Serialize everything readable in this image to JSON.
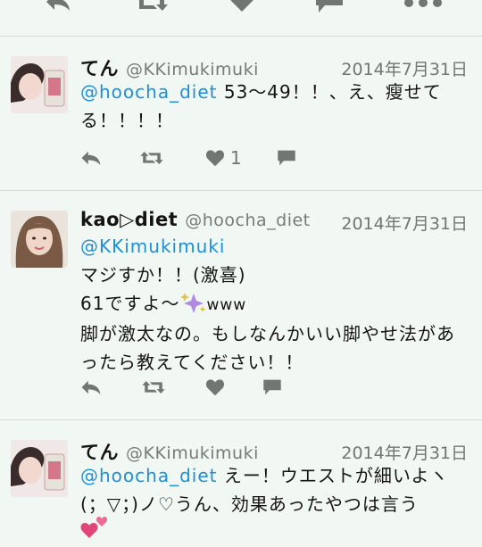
{
  "colors": {
    "background": "#f1f7f2",
    "mention": "#1f8fd6",
    "icon": "#6f7770",
    "divider": "#d6dcd6"
  },
  "top_bar": {
    "icons": [
      "reply-icon",
      "retweet-icon",
      "heart-icon",
      "message-icon",
      "more-icon"
    ]
  },
  "tweets": [
    {
      "name": "てん",
      "handle": "@KKimukimuki",
      "date": "2014年7月31日",
      "mention": "@hoocha_diet",
      "text": " 53〜49！！、え、瘦せてる！！！！",
      "like_count": "1"
    },
    {
      "name": "kao▷diet",
      "handle": "@hoocha_diet",
      "date": "2014年7月31日",
      "mention": "@KKimukimuki",
      "lines": [
        "マジすか！！(激喜)",
        "61ですよ〜",
        "www",
        "脚が激太なの。もしなんかいい脚やせ法があったら教えてください！！"
      ],
      "emoji": "sparkles"
    },
    {
      "name": "てん",
      "handle": "@KKimukimuki",
      "date": "2014年7月31日",
      "mention": "@hoocha_diet",
      "text": " えー！ウエストが細いよヽ(；▽；)ノ♡うん、効果あったやつは言う",
      "emoji": "two-hearts"
    }
  ]
}
